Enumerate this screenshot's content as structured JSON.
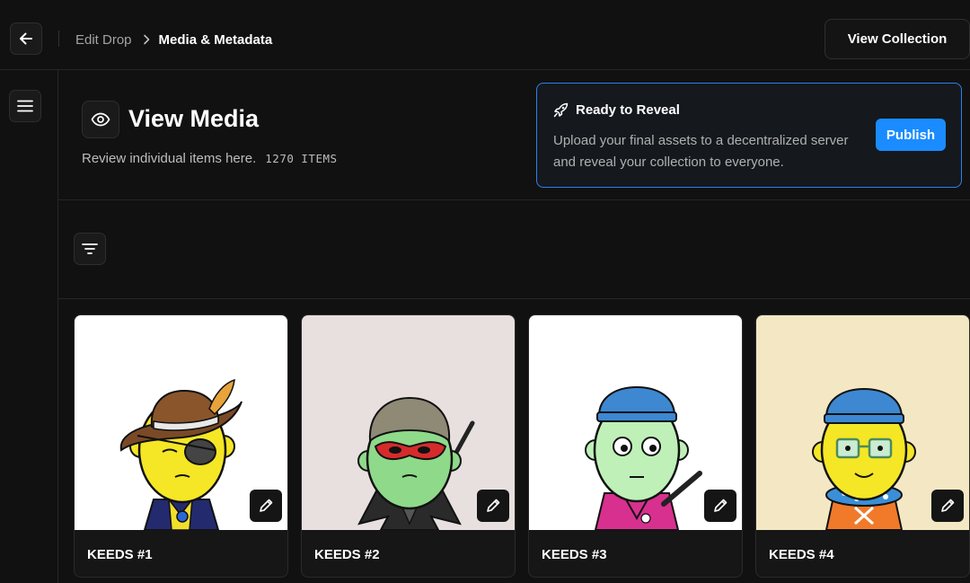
{
  "topbar": {
    "breadcrumb_prev": "Edit Drop",
    "breadcrumb_current": "Media & Metadata",
    "view_collection_label": "View Collection"
  },
  "header": {
    "title": "View Media",
    "subtitle": "Review individual items here.",
    "items_count": "1270 ITEMS"
  },
  "reveal": {
    "title": "Ready to Reveal",
    "text": "Upload your final assets to a decentralized server and reveal your collection to everyone.",
    "publish_label": "Publish",
    "accent_color": "#2f80ed",
    "button_color": "#1a8cff"
  },
  "icons": {
    "back": "arrow-left-icon",
    "menu": "hamburger-menu-icon",
    "view": "eye-icon",
    "reveal": "rocket-icon",
    "filter": "filter-icon",
    "edit": "pencil-icon"
  },
  "items": [
    {
      "name": "KEEDS #1",
      "bg": "#ffffff"
    },
    {
      "name": "KEEDS #2",
      "bg": "#e7e0df"
    },
    {
      "name": "KEEDS #3",
      "bg": "#ffffff"
    },
    {
      "name": "KEEDS #4",
      "bg": "#f3e8c3"
    }
  ]
}
